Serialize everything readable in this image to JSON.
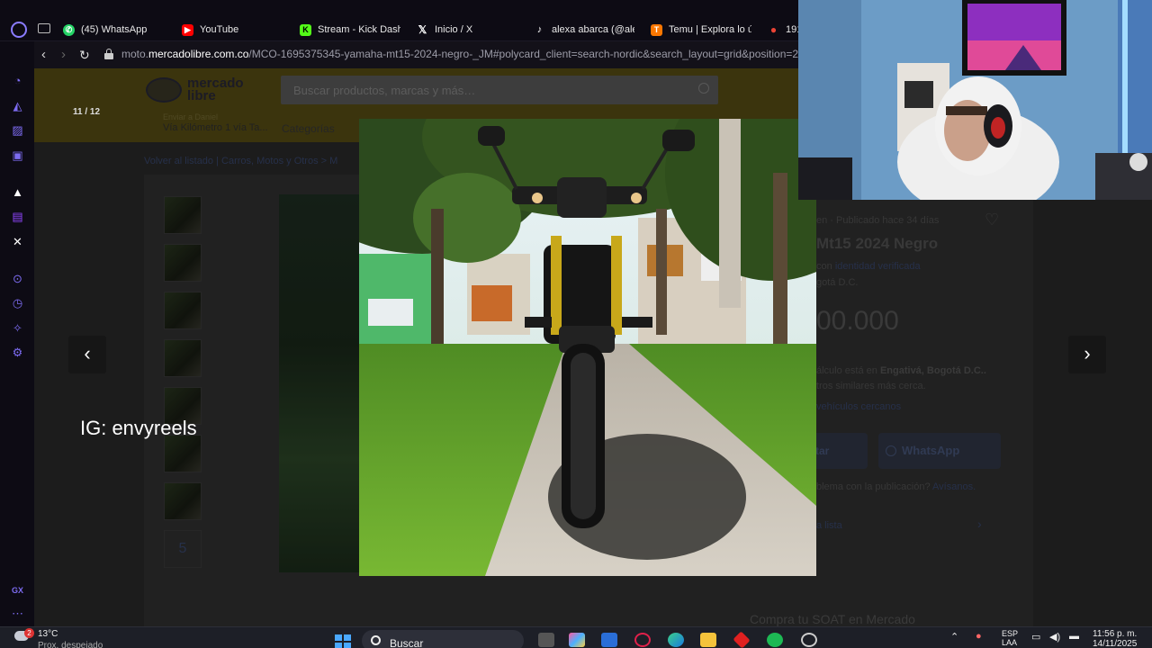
{
  "tabs": [
    {
      "label": "(45) WhatsApp",
      "icon": "whatsapp-icon",
      "color": "#25d366"
    },
    {
      "label": "YouTube",
      "icon": "youtube-icon",
      "color": "#ff0000"
    },
    {
      "label": "Stream - Kick Dash",
      "icon": "kick-icon",
      "color": "#53fc18"
    },
    {
      "label": "Inicio / X",
      "icon": "x-icon",
      "color": "#ffffff"
    },
    {
      "label": "alexa abarca (@ale",
      "icon": "tiktok-icon",
      "color": "#ffffff"
    },
    {
      "label": "Temu | Explora lo ú",
      "icon": "temu-icon",
      "color": "#fb7701"
    },
    {
      "label": "191",
      "icon": "maps-icon",
      "color": "#ea4335"
    }
  ],
  "address": {
    "prefix": "moto.",
    "domain": "mercadolibre.com.co",
    "path": "/MCO-1695375345-yamaha-mt15-2024-negro-_JM#polycard_client=search-nordic&search_layout=grid&position=2&typ"
  },
  "ml": {
    "logo_line1": "mercado",
    "logo_line2": "libre",
    "search_placeholder": "Buscar productos, marcas y más…",
    "location_label": "Enviar a Daniel",
    "location": "Vía Kilómetro 1 vía Ta...",
    "categories": "Categorías",
    "breadcrumb": "Volver al listado  |  Carros, Motos y Otros  >  M",
    "more_thumbs": "5",
    "condition": "en · Publicado hace 34 días",
    "title": "Mt15 2024 Negro",
    "seller_prefix": "con",
    "seller_link": "identidad verificada",
    "city": "gotá D.C.",
    "price": "00.000",
    "ship_line1_a": "álculo está en",
    "ship_line1_b": "Engativá, Bogotá D.C..",
    "ship_line2": "tros similares más cerca.",
    "ship_line3": "vehículos cercanos",
    "contact_btn": "tar",
    "whatsapp_btn": "WhatsApp",
    "report_text": "blema con la publicación?",
    "report_link": "Avísanos.",
    "list_link": "a lista",
    "soat": "Compra tu SOAT en Mercado"
  },
  "lightbox": {
    "counter": "11 / 12",
    "watermark": "IG: envyreels"
  },
  "taskbar": {
    "badge": "2",
    "temperature": "13°C",
    "weather": "Prox. despejado",
    "search_label": "Buscar",
    "lang1": "ESP",
    "lang2": "LAA",
    "time": "11:56 p. m.",
    "date": "14/11/2025"
  },
  "colors": {
    "accent": "#7d6cf2",
    "ml_yellow_dimmed": "#5b5114",
    "ml_link": "#3b4a72"
  }
}
